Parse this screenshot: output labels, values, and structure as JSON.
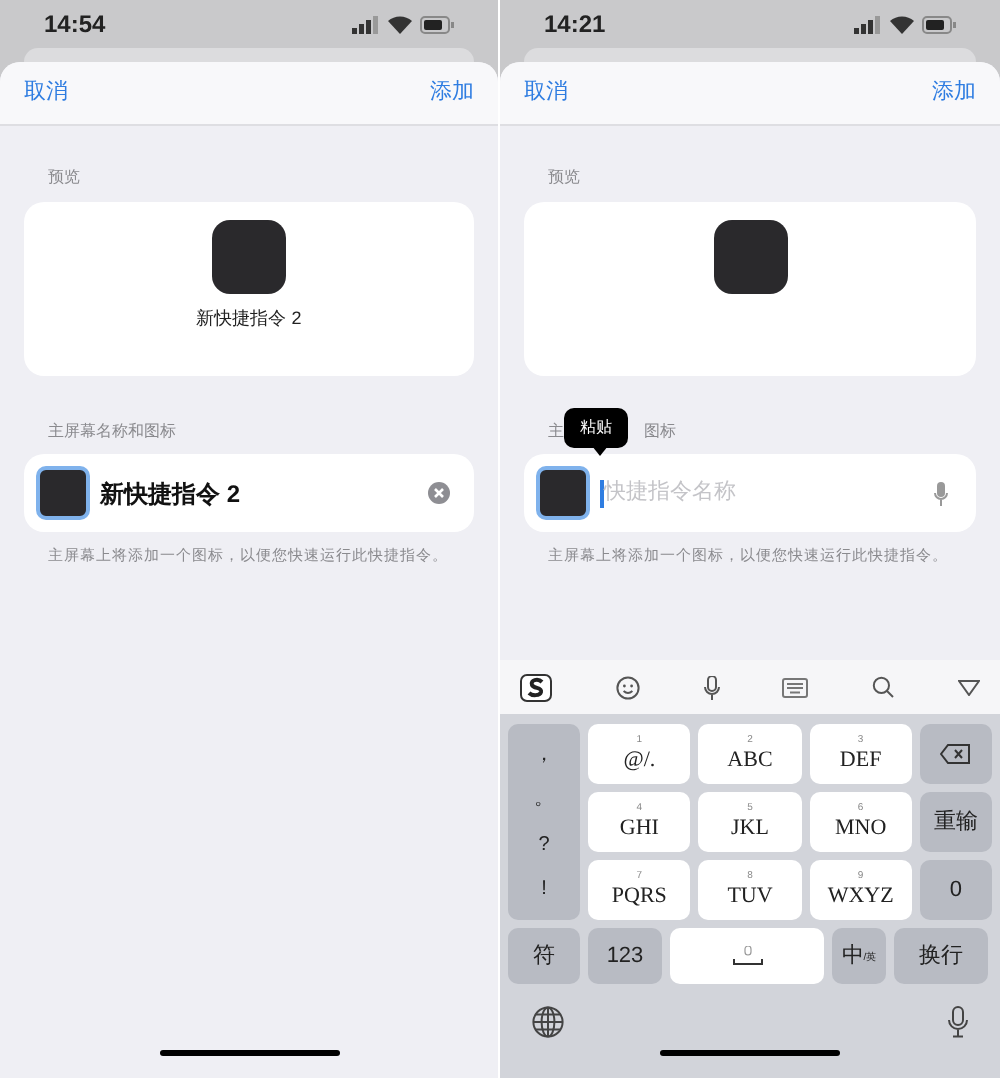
{
  "screens": [
    {
      "status_bar": {
        "time": "14:54"
      },
      "nav": {
        "cancel": "取消",
        "add": "添加"
      },
      "preview": {
        "label": "预览",
        "name": "新快捷指令 2"
      },
      "name_section": {
        "label": [
          "主屏幕名称和图标"
        ],
        "field": {
          "value": "新快捷指令 2",
          "focused": false,
          "clear_button": true,
          "dictation_button": false
        },
        "hint": "主屏幕上将添加一个图标，以便您快速运行此快捷指令。"
      }
    },
    {
      "status_bar": {
        "time": "14:21"
      },
      "nav": {
        "cancel": "取消",
        "add": "添加"
      },
      "preview": {
        "label": "预览"
      },
      "name_section": {
        "label": [
          "主",
          "图标"
        ],
        "field": {
          "placeholder": "快捷指令名称",
          "focused": true,
          "clear_button": false,
          "dictation_button": true
        },
        "hint": "主屏幕上将添加一个图标，以便您快速运行此快捷指令。"
      },
      "tooltip": "粘贴",
      "keyboard": {
        "punctuation": [
          "，",
          "。",
          "?",
          "!"
        ],
        "keys": [
          {
            "digit": "1",
            "label": "@/."
          },
          {
            "digit": "2",
            "label": "ABC"
          },
          {
            "digit": "3",
            "label": "DEF"
          },
          {
            "digit": "4",
            "label": "GHI"
          },
          {
            "digit": "5",
            "label": "JKL"
          },
          {
            "digit": "6",
            "label": "MNO"
          },
          {
            "digit": "7",
            "label": "PQRS"
          },
          {
            "digit": "8",
            "label": "TUV"
          },
          {
            "digit": "9",
            "label": "WXYZ"
          }
        ],
        "right_keys": [
          "重输",
          "0"
        ],
        "bottom_row": [
          {
            "kind": "key",
            "label": "符"
          },
          {
            "kind": "key",
            "label": "123"
          },
          {
            "kind": "space"
          },
          {
            "kind": "key",
            "label": "中$_{/英}$"
          },
          {
            "kind": "key",
            "label": "换行"
          }
        ]
      }
    }
  ]
}
